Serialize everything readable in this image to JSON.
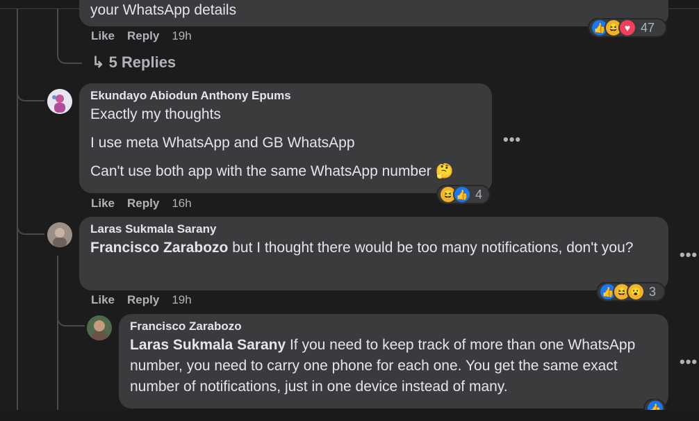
{
  "top_comment": {
    "text_partial": "your WhatsApp details",
    "actions": {
      "like": "Like",
      "reply": "Reply",
      "time": "19h"
    },
    "reactions": {
      "icons": [
        "like-icon",
        "haha-icon",
        "love-icon"
      ],
      "count": "47"
    },
    "replies_link": "5 Replies"
  },
  "comments": [
    {
      "author": "Ekundayo Abiodun Anthony Epums",
      "lines": [
        "Exactly my thoughts",
        "I use meta WhatsApp and GB WhatsApp",
        "Can't use both app with the same WhatsApp number 🤔"
      ],
      "actions": {
        "like": "Like",
        "reply": "Reply",
        "time": "16h"
      },
      "reactions": {
        "icons": [
          "haha-icon",
          "like-icon"
        ],
        "count": "4"
      }
    },
    {
      "author": "Laras Sukmala Sarany",
      "mention": "Francisco Zarabozo",
      "text": " but I thought there would be too many notifications, don't you?",
      "actions": {
        "like": "Like",
        "reply": "Reply",
        "time": "19h"
      },
      "reactions": {
        "icons": [
          "like-icon",
          "haha-icon",
          "wow-icon"
        ],
        "count": "3"
      }
    },
    {
      "author": "Francisco Zarabozo",
      "mention": "Laras Sukmala Sarany",
      "text": " If you need to keep track of more than one WhatsApp number, you need to carry one phone for each one. You get the same exact number of notifications, just in one device instead of many.",
      "reactions": {
        "icons": [
          "like-icon"
        ]
      }
    }
  ],
  "more_label": "•••",
  "colors": {
    "bubble": "#3a3b3c",
    "background": "#1c1c1d",
    "like": "#1877f2",
    "haha": "#f7b125",
    "love": "#f33e58"
  }
}
